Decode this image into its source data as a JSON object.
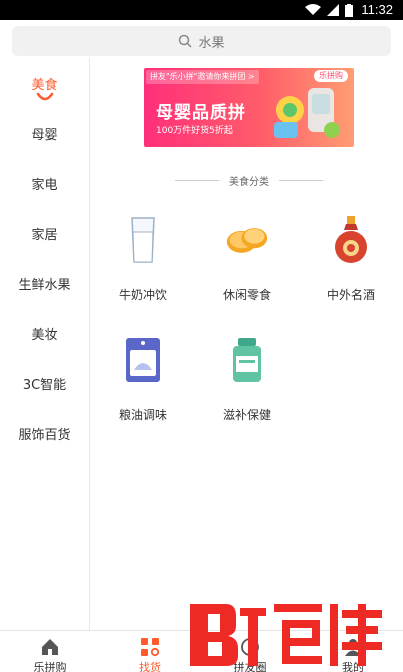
{
  "status": {
    "time": "11:32"
  },
  "search": {
    "placeholder": "水果"
  },
  "sidebar": {
    "items": [
      {
        "label": "美食",
        "active": true
      },
      {
        "label": "母婴"
      },
      {
        "label": "家电"
      },
      {
        "label": "家居"
      },
      {
        "label": "生鲜水果"
      },
      {
        "label": "美妆"
      },
      {
        "label": "3C智能"
      },
      {
        "label": "服饰百货"
      }
    ]
  },
  "banner": {
    "tag": "拼友\"乐小拼\"邀请你来拼团 >",
    "badge": "乐拼购",
    "title": "母婴品质拼",
    "subtitle": "100万件好货5折起"
  },
  "section": {
    "title": "美食分类"
  },
  "categories": [
    {
      "label": "牛奶冲饮",
      "icon": "milk-glass-icon"
    },
    {
      "label": "休闲零食",
      "icon": "snack-cookie-icon"
    },
    {
      "label": "中外名酒",
      "icon": "liquor-bottle-icon"
    },
    {
      "label": "粮油调味",
      "icon": "grain-bag-icon"
    },
    {
      "label": "滋补保健",
      "icon": "supplement-jar-icon"
    }
  ],
  "tabbar": {
    "tabs": [
      {
        "label": "乐拼购",
        "icon": "home-icon"
      },
      {
        "label": "找货",
        "icon": "grid-search-icon",
        "active": true
      },
      {
        "label": "拼友圈",
        "icon": "circle-icon"
      },
      {
        "label": "我的",
        "icon": "user-icon"
      }
    ]
  },
  "watermark": {
    "text": "百佳"
  },
  "colors": {
    "accent": "#ff5a2d",
    "statusbar": "#000000"
  }
}
